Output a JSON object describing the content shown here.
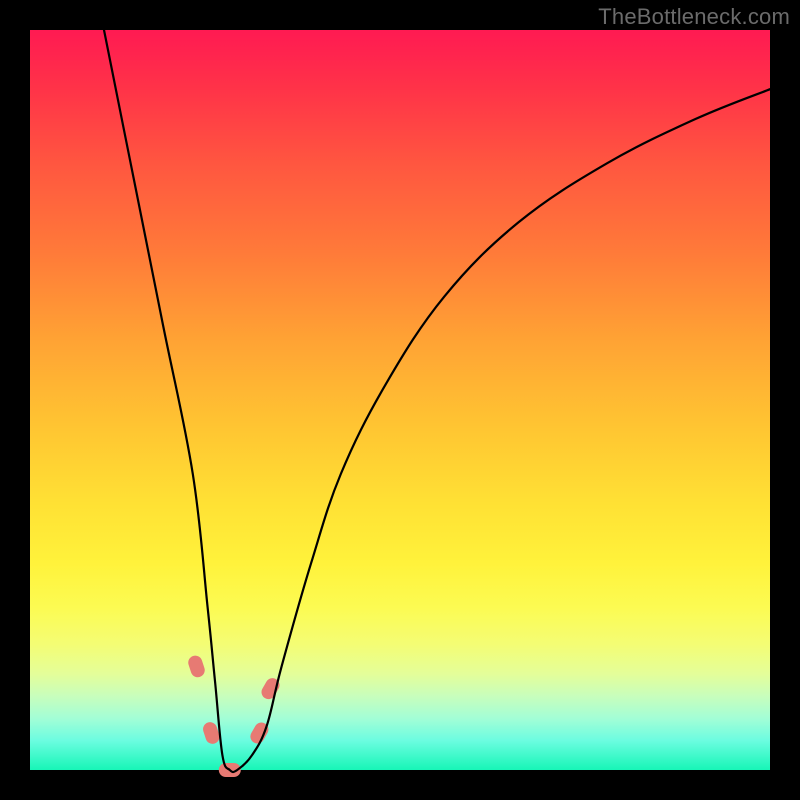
{
  "watermark": "TheBottleneck.com",
  "chart_data": {
    "type": "line",
    "title": "",
    "xlabel": "",
    "ylabel": "",
    "xlim": [
      0,
      100
    ],
    "ylim": [
      0,
      100
    ],
    "grid": false,
    "legend": false,
    "note": "Values estimated from pixel positions; chart has no numeric axis ticks or labels.",
    "series": [
      {
        "name": "bottleneck-curve",
        "color": "#000000",
        "x": [
          10,
          14,
          18,
          22,
          24,
          25,
          26,
          27,
          28,
          30,
          32,
          34,
          38,
          42,
          48,
          56,
          66,
          78,
          90,
          100
        ],
        "y": [
          100,
          80,
          60,
          40,
          22,
          12,
          2,
          0,
          0,
          2,
          6,
          14,
          28,
          40,
          52,
          64,
          74,
          82,
          88,
          92
        ]
      }
    ],
    "markers": [
      {
        "name": "marker-left-upper",
        "x": 22.5,
        "y": 14,
        "color": "#e77a73"
      },
      {
        "name": "marker-left-lower",
        "x": 24.5,
        "y": 5,
        "color": "#e77a73"
      },
      {
        "name": "marker-bottom",
        "x": 27.0,
        "y": 0,
        "color": "#e77a73"
      },
      {
        "name": "marker-right-lower",
        "x": 31.0,
        "y": 5,
        "color": "#e77a73"
      },
      {
        "name": "marker-right-upper",
        "x": 32.5,
        "y": 11,
        "color": "#e77a73"
      }
    ],
    "background_gradient": {
      "top": "#ff1a52",
      "mid": "#ffe134",
      "bottom": "#17f6b7"
    }
  }
}
